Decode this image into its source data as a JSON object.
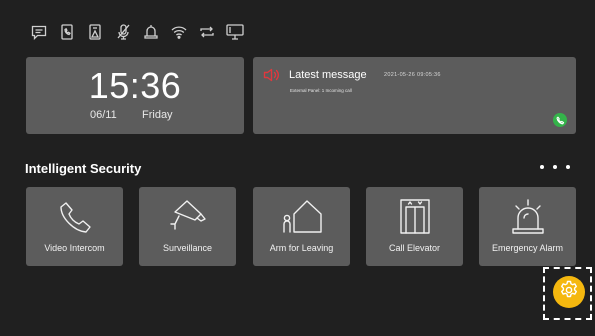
{
  "status_icons": [
    "message-icon",
    "door-phone-icon",
    "door-sensor-icon",
    "mute-mic-icon",
    "alarm-bell-icon",
    "wifi-icon",
    "sync-icon",
    "monitor-icon"
  ],
  "clock": {
    "time": "15:36",
    "date": "06/11",
    "weekday": "Friday"
  },
  "message": {
    "title": "Latest message",
    "timestamp": "2021-05-26  09:05:36",
    "body": "External Panel: 1  Incoming call"
  },
  "section": {
    "title": "Intelligent Security"
  },
  "tiles": [
    {
      "label": "Video Intercom",
      "icon": "phone-icon"
    },
    {
      "label": "Surveillance",
      "icon": "camera-icon"
    },
    {
      "label": "Arm for Leaving",
      "icon": "house-person-icon"
    },
    {
      "label": "Call Elevator",
      "icon": "elevator-icon"
    },
    {
      "label": "Emergency Alarm",
      "icon": "siren-icon"
    }
  ],
  "colors": {
    "background": "#202020",
    "card": "#5c5c5c",
    "accent": "#f5b80f",
    "speaker": "#e0383e",
    "call": "#34b34a"
  }
}
